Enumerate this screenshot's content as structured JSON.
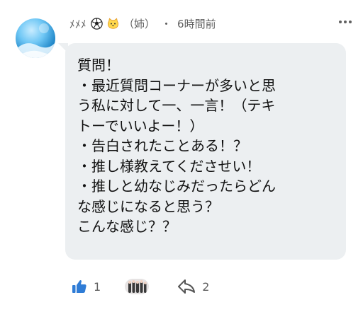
{
  "comment": {
    "username": "ﾒﾒﾒ",
    "username_suffix": "（姉）",
    "separator": "・",
    "timestamp": "6時間前",
    "message": "質問！\n・最近質問コーナーが多いと思\nう私に対して一、一言！（テキ\nトーでいいよー！）\n・告白されたことある！？\n・推し様教えてくださせい！\n・推しと幼なじみだったらどん\nな感じになると思う？\nこんな感じ？？",
    "icons": {
      "avatar": "avatar-image",
      "username_emojis": [
        "soccer-ball-icon",
        "cat-face-icon"
      ],
      "more": "more-options-icon",
      "like": "thumbs-up-icon",
      "reply": "reply-arrow-icon"
    }
  },
  "actions": {
    "like_count": "1",
    "reply_count": "2"
  },
  "colors": {
    "bubble": "#eceff1",
    "accent": "#2f7cd6",
    "muted_text": "#606060"
  }
}
